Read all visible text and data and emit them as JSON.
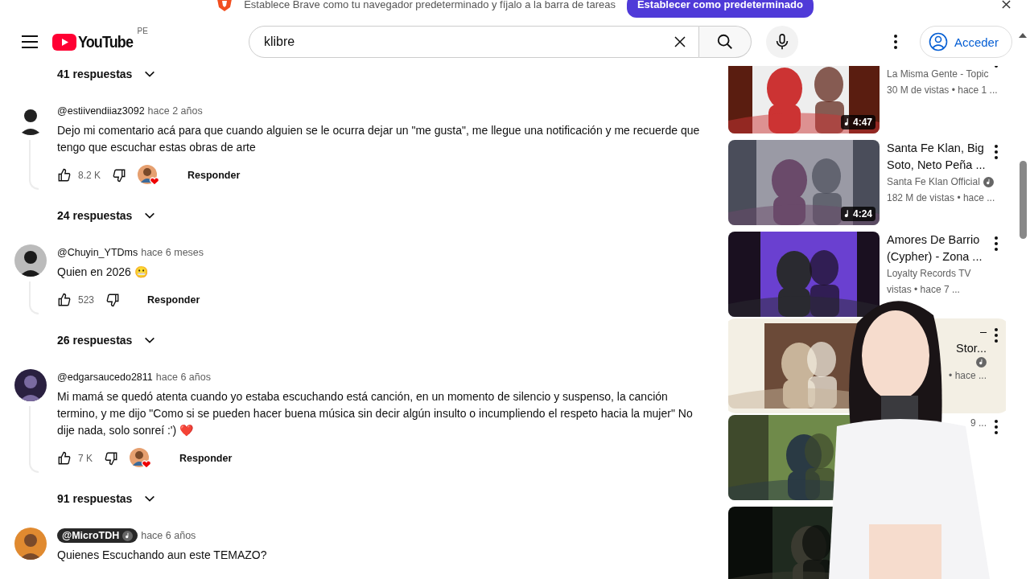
{
  "banner": {
    "text": "Establece Brave como tu navegador predeterminado y fíjalo a la barra de tareas",
    "button": "Establecer como predeterminado"
  },
  "header": {
    "logo_text": "YouTube",
    "region": "PE",
    "search": {
      "value": "klibre"
    },
    "sign_in": "Acceder"
  },
  "comments": {
    "top_replies": "41 respuestas",
    "items": [
      {
        "author": "@estiivendiiaz3092",
        "verified": false,
        "time": "hace 2 años",
        "text": "Dejo mi comentario acá para que cuando alguien se le ocurra dejar un \"me gusta\", me llegue una notificación y me recuerde que tengo que escuchar estas obras de arte",
        "likes": "8.2 K",
        "creator_heart": true,
        "reply": "Responder",
        "replies": "24 respuestas"
      },
      {
        "author": "@Chuyin_YTDms",
        "verified": false,
        "time": "hace 6 meses",
        "text": "Quien en 2026 😬",
        "likes": "523",
        "creator_heart": false,
        "reply": "Responder",
        "replies": "26 respuestas"
      },
      {
        "author": "@edgarsaucedo2811",
        "verified": false,
        "time": "hace 6 años",
        "text": "Mi mamá se quedó atenta cuando yo estaba escuchando está canción, en un momento de silencio y suspenso, la canción termino, y me dijo \"Como si se pueden hacer buena música sin decir algún insulto o incumpliendo el respeto hacia la mujer\" No dije nada, solo sonreí :') ❤️",
        "likes": "7 K",
        "creator_heart": true,
        "reply": "Responder",
        "replies": "91 respuestas"
      },
      {
        "author": "@MicroTDH",
        "verified": true,
        "time": "hace 6 años",
        "text": "Quienes Escuchando aun este TEMAZO?"
      }
    ]
  },
  "related": [
    {
      "channel": "La Misma Gente - Topic",
      "channel_verified": false,
      "meta": "30 M de vistas • hace 1 ...",
      "duration": "4:47",
      "hovered": false
    },
    {
      "title": "Santa Fe Klan, Big Soto, Neto Peña ...",
      "channel": "Santa Fe Klan Official",
      "channel_verified": true,
      "meta": "182 M de vistas • hace ...",
      "duration": "4:24",
      "hovered": false
    },
    {
      "title": "Amores De Barrio (Cypher) - Zona ...",
      "channel": "Loyalty Records TV",
      "channel_verified": false,
      "meta": "vistas • hace 7 ...",
      "hovered": false
    },
    {
      "title": "–\nStor...",
      "channel_verified": true,
      "meta": "• hace ...",
      "hovered": true
    },
    {
      "meta": "9 ...",
      "hovered": false
    },
    {
      "hovered": false
    }
  ]
}
